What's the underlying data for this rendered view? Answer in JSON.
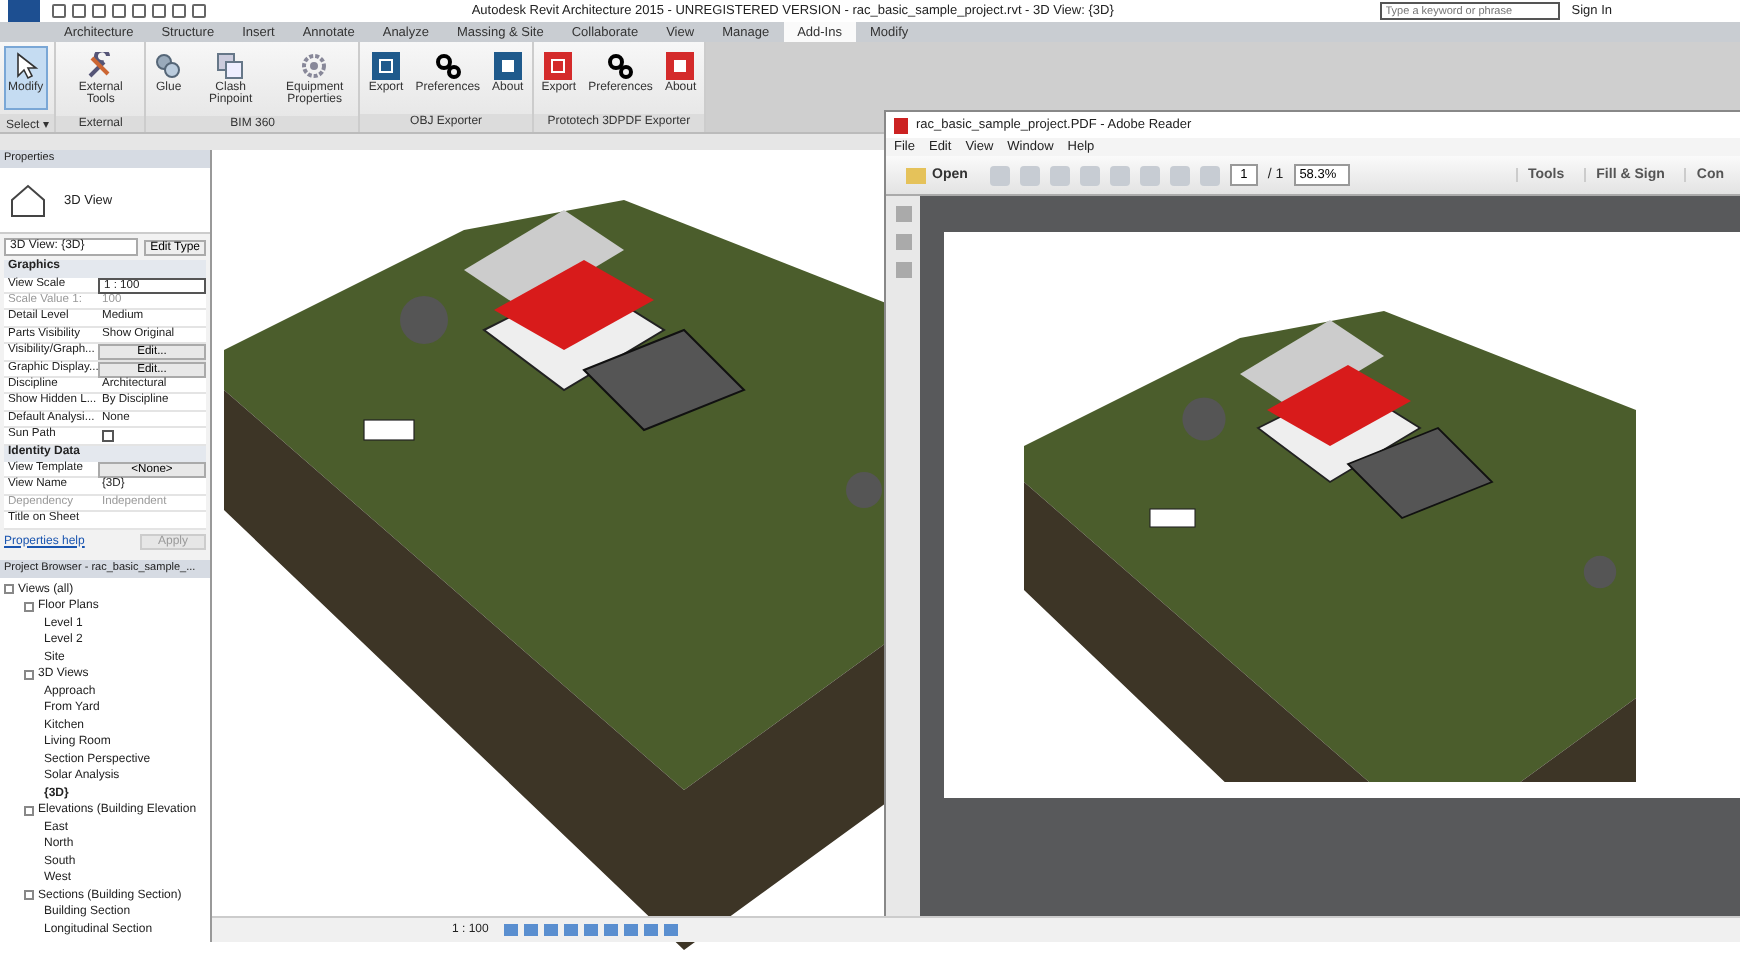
{
  "window": {
    "title": "Autodesk Revit Architecture 2015 - UNREGISTERED VERSION - rac_basic_sample_project.rvt - 3D View: {3D}"
  },
  "search": {
    "placeholder": "Type a keyword or phrase"
  },
  "sign_in": "Sign In",
  "tabs": [
    {
      "label": "Architecture",
      "selected": false
    },
    {
      "label": "Structure",
      "selected": false
    },
    {
      "label": "Insert",
      "selected": false
    },
    {
      "label": "Annotate",
      "selected": false
    },
    {
      "label": "Analyze",
      "selected": false
    },
    {
      "label": "Massing & Site",
      "selected": false
    },
    {
      "label": "Collaborate",
      "selected": false
    },
    {
      "label": "View",
      "selected": false
    },
    {
      "label": "Manage",
      "selected": false
    },
    {
      "label": "Add-Ins",
      "selected": true
    },
    {
      "label": "Modify",
      "selected": false
    }
  ],
  "ribbon": [
    {
      "label": "Select ▾",
      "tools": [
        {
          "label": "Modify",
          "kind": "cursor",
          "selected": true
        }
      ]
    },
    {
      "label": "External",
      "tools": [
        {
          "label": "External Tools",
          "kind": "tools",
          "selected": false
        }
      ]
    },
    {
      "label": "BIM 360",
      "tools": [
        {
          "label": "Glue",
          "kind": "glue",
          "selected": false
        },
        {
          "label": "Clash Pinpoint",
          "kind": "clash",
          "selected": false
        },
        {
          "label": "Equipment Properties",
          "kind": "equipment",
          "selected": false
        }
      ]
    },
    {
      "label": "OBJ Exporter",
      "tools": [
        {
          "label": "Export",
          "kind": "obj",
          "selected": false
        },
        {
          "label": "Preferences",
          "kind": "gears",
          "selected": false
        },
        {
          "label": "About",
          "kind": "obj-about",
          "selected": false
        }
      ]
    },
    {
      "label": "Prototech 3DPDF Exporter",
      "tools": [
        {
          "label": "Export",
          "kind": "pdf",
          "selected": false
        },
        {
          "label": "Preferences",
          "kind": "gears",
          "selected": false
        },
        {
          "label": "About",
          "kind": "pdf-about",
          "selected": false
        }
      ]
    }
  ],
  "properties": {
    "title": "Properties",
    "type_name": "3D View",
    "view_selector": "3D View: {3D}",
    "edit_type": "Edit Type",
    "rows": [
      {
        "kind": "group",
        "label": "Graphics"
      },
      {
        "kind": "field",
        "label": "View Scale",
        "value": "1 : 100",
        "disabled": false
      },
      {
        "kind": "text",
        "label": "Scale Value    1:",
        "value": "100",
        "disabled": true
      },
      {
        "kind": "text",
        "label": "Detail Level",
        "value": "Medium",
        "disabled": false
      },
      {
        "kind": "text",
        "label": "Parts Visibility",
        "value": "Show Original",
        "disabled": false
      },
      {
        "kind": "button",
        "label": "Visibility/Graph...",
        "value": "Edit...",
        "disabled": false
      },
      {
        "kind": "button",
        "label": "Graphic Display...",
        "value": "Edit...",
        "disabled": false
      },
      {
        "kind": "text",
        "label": "Discipline",
        "value": "Architectural",
        "disabled": false
      },
      {
        "kind": "text",
        "label": "Show Hidden L...",
        "value": "By Discipline",
        "disabled": false
      },
      {
        "kind": "text",
        "label": "Default Analysi...",
        "value": "None",
        "disabled": false
      },
      {
        "kind": "checkbox",
        "label": "Sun Path",
        "checked": false,
        "disabled": false
      },
      {
        "kind": "group",
        "label": "Identity Data"
      },
      {
        "kind": "button",
        "label": "View Template",
        "value": "<None>",
        "disabled": false
      },
      {
        "kind": "text",
        "label": "View Name",
        "value": "{3D}",
        "disabled": false
      },
      {
        "kind": "text",
        "label": "Dependency",
        "value": "Independent",
        "disabled": true
      },
      {
        "kind": "text",
        "label": "Title on Sheet",
        "value": "",
        "disabled": false
      }
    ],
    "help": "Properties help",
    "apply": "Apply"
  },
  "browser": {
    "title": "Project Browser - rac_basic_sample_...",
    "tree": [
      {
        "label": "Views (all)",
        "expanded": true,
        "selected": false,
        "children": [
          {
            "label": "Floor Plans",
            "expanded": true,
            "selected": false,
            "children": [
              {
                "label": "Level 1",
                "selected": false
              },
              {
                "label": "Level 2",
                "selected": false
              },
              {
                "label": "Site",
                "selected": false
              }
            ]
          },
          {
            "label": "3D Views",
            "expanded": true,
            "selected": false,
            "children": [
              {
                "label": "Approach",
                "selected": false
              },
              {
                "label": "From Yard",
                "selected": false
              },
              {
                "label": "Kitchen",
                "selected": false
              },
              {
                "label": "Living Room",
                "selected": false
              },
              {
                "label": "Section Perspective",
                "selected": false
              },
              {
                "label": "Solar Analysis",
                "selected": false
              },
              {
                "label": "{3D}",
                "selected": true
              }
            ]
          },
          {
            "label": "Elevations (Building Elevation",
            "expanded": true,
            "selected": false,
            "children": [
              {
                "label": "East",
                "selected": false
              },
              {
                "label": "North",
                "selected": false
              },
              {
                "label": "South",
                "selected": false
              },
              {
                "label": "West",
                "selected": false
              }
            ]
          },
          {
            "label": "Sections (Building Section)",
            "expanded": true,
            "selected": false,
            "children": [
              {
                "label": "Building Section",
                "selected": false
              },
              {
                "label": "Longitudinal Section",
                "selected": false
              }
            ]
          }
        ]
      }
    ]
  },
  "status_bar": {
    "scale": "1 : 100"
  },
  "reader": {
    "title": "rac_basic_sample_project.PDF - Adobe Reader",
    "menu": [
      "File",
      "Edit",
      "View",
      "Window",
      "Help"
    ],
    "open": "Open",
    "page": "1",
    "page_total": "/ 1",
    "zoom": "58.3%",
    "tools": [
      "Tools",
      "Fill & Sign",
      "Con"
    ]
  }
}
